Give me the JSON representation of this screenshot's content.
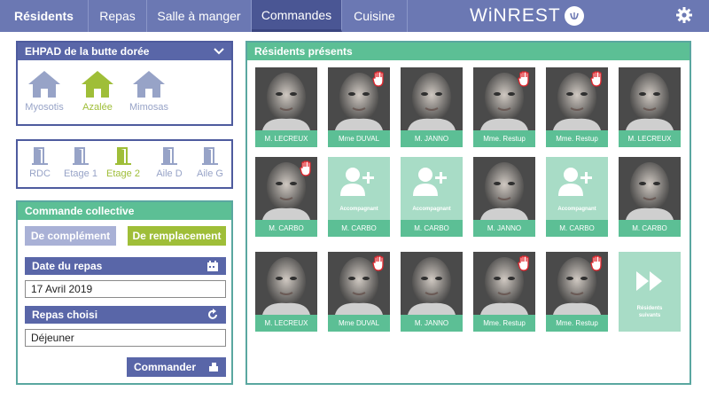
{
  "nav": {
    "tabs": [
      {
        "label": "Résidents"
      },
      {
        "label": "Repas"
      },
      {
        "label": "Salle à manger"
      },
      {
        "label": "Commandes"
      },
      {
        "label": "Cuisine"
      }
    ],
    "active_tab": "Commandes",
    "brand": "WiNREST",
    "settings_icon": "gear-icon"
  },
  "site": {
    "title": "EHPAD de la butte dorée",
    "units": [
      {
        "label": "Myosotis",
        "icon": "house-icon",
        "selected": false
      },
      {
        "label": "Azalée",
        "icon": "house-icon",
        "selected": true
      },
      {
        "label": "Mimosas",
        "icon": "house-icon",
        "selected": false
      }
    ],
    "floors": [
      {
        "label": "RDC",
        "icon": "door-icon",
        "selected": false
      },
      {
        "label": "Etage 1",
        "icon": "door-icon",
        "selected": false
      },
      {
        "label": "Etage 2",
        "icon": "door-icon",
        "selected": true
      },
      {
        "label": "Aile D",
        "icon": "door-icon",
        "selected": false
      },
      {
        "label": "Aile G",
        "icon": "door-icon",
        "selected": false
      }
    ]
  },
  "order": {
    "title": "Commande collective",
    "complement_label": "De complément",
    "replacement_label": "De remplacement",
    "date_label": "Date du repas",
    "date_value": "17 Avril 2019",
    "meal_label": "Repas choisi",
    "meal_value": "Déjeuner",
    "submit_label": "Commander"
  },
  "residents": {
    "title": "Résidents présents",
    "cards": [
      {
        "name": "M. LECREUX",
        "type": "photo",
        "hand": false
      },
      {
        "name": "Mme DUVAL",
        "type": "photo",
        "hand": true
      },
      {
        "name": "M. JANNO",
        "type": "photo",
        "hand": false
      },
      {
        "name": "Mme. Restup",
        "type": "photo",
        "hand": true
      },
      {
        "name": "Mme. Restup",
        "type": "photo",
        "hand": true
      },
      {
        "name": "M. LECREUX",
        "type": "photo",
        "hand": false
      },
      {
        "name": "M. CARBO",
        "type": "photo",
        "hand": true
      },
      {
        "name": "M. CARBO",
        "type": "companion",
        "hand": false,
        "sub": "Accompagnant"
      },
      {
        "name": "M. CARBO",
        "type": "companion",
        "hand": false,
        "sub": "Accompagnant"
      },
      {
        "name": "M. JANNO",
        "type": "photo",
        "hand": false
      },
      {
        "name": "M. CARBO",
        "type": "companion",
        "hand": false,
        "sub": "Accompagnant"
      },
      {
        "name": "M. CARBO",
        "type": "photo",
        "hand": false
      },
      {
        "name": "M. LECREUX",
        "type": "photo",
        "hand": false
      },
      {
        "name": "Mme DUVAL",
        "type": "photo",
        "hand": true
      },
      {
        "name": "M. JANNO",
        "type": "photo",
        "hand": false
      },
      {
        "name": "Mme. Restup",
        "type": "photo",
        "hand": true
      },
      {
        "name": "Mme. Restup",
        "type": "photo",
        "hand": true
      }
    ],
    "next_line1": "Résidents",
    "next_line2": "suivants"
  },
  "colors": {
    "nav": "#6b78b3",
    "nav_active": "#4a5694",
    "accent_green": "#5cbf95",
    "light_green": "#a8dcc6",
    "olive": "#9fbe38",
    "blue_dark": "#5966a8",
    "muted_icon": "#97a3c7"
  }
}
